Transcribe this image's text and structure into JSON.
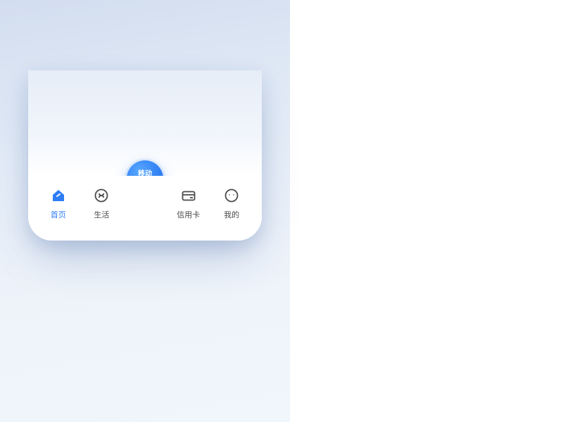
{
  "colors": {
    "accent": "#2f7df6",
    "gradient_start": "#5aa8ff",
    "gradient_end": "#1e6be8"
  },
  "tabs": {
    "home": {
      "label": "首页",
      "icon": "home-icon",
      "active": true
    },
    "life": {
      "label": "生活",
      "icon": "knot-icon",
      "active": false
    },
    "center": {
      "label": "移动\n支付",
      "icon": "",
      "active": false
    },
    "card": {
      "label": "信用卡",
      "icon": "card-icon",
      "active": false
    },
    "mine": {
      "label": "我的",
      "icon": "face-icon",
      "active": false
    }
  }
}
